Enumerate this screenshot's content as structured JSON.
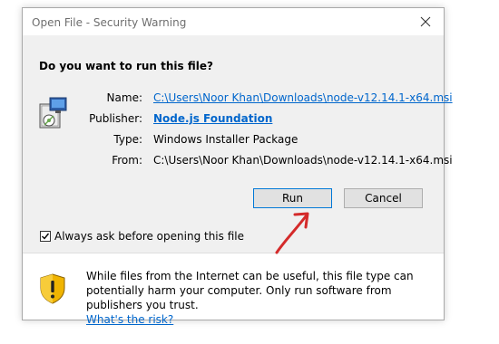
{
  "window": {
    "title": "Open File - Security Warning",
    "close_glyph": "✕"
  },
  "prompt": {
    "question": "Do you want to run this file?"
  },
  "file_info": {
    "name_label": "Name:",
    "name_value": "C:\\Users\\Noor Khan\\Downloads\\node-v12.14.1-x64.msi",
    "publisher_label": "Publisher:",
    "publisher_value": "Node.js Foundation",
    "type_label": "Type:",
    "type_value": "Windows Installer Package",
    "from_label": "From:",
    "from_value": "C:\\Users\\Noor Khan\\Downloads\\node-v12.14.1-x64.msi"
  },
  "buttons": {
    "run_label": "Run",
    "cancel_label": "Cancel"
  },
  "checkbox": {
    "label": "Always ask before opening this file",
    "checked": true,
    "check_glyph": "✓"
  },
  "warning": {
    "text": "While files from the Internet can be useful, this file type can potentially harm your computer. Only run software from publishers you trust.",
    "link_text": "What's the risk?"
  },
  "colors": {
    "link": "#0066cc",
    "annotation_arrow": "#d42a2a",
    "shield_yellow": "#f0b400",
    "run_button_border": "#0078d7"
  },
  "icons": {
    "file": "installer-package-icon",
    "warning": "shield-warning-icon",
    "annotation": "red-arrow-annotation"
  }
}
